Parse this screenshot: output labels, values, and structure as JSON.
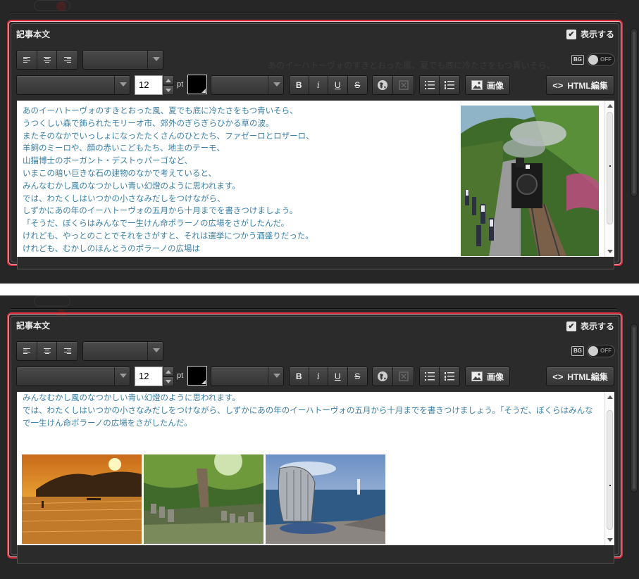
{
  "editor": {
    "title": "記事本文",
    "show_label": "表示する",
    "show_checked": true,
    "bg_label": "BG",
    "bg_toggle_label": "OFF",
    "font_size": "12",
    "font_unit": "pt",
    "text_color": "#000000",
    "bold_label": "B",
    "italic_label": "i",
    "underline_label": "U",
    "strike_label": "S",
    "image_button_label": "画像",
    "html_edit_label": "HTML編集",
    "code_glyph": "〈〉"
  },
  "screen1": {
    "text_lines": [
      "あのイーハトーヴォのすきとおった風、夏でも底に冷たさをもつ青いそら、",
      "うつくしい森で飾られたモリーオ市、郊外のぎらぎらひかる草の波。",
      "またそのなかでいっしょになったたくさんのひとたち、ファゼーロとロザーロ、",
      "羊飼のミーロや、顔の赤いこどもたち、地主のテーモ、",
      "山猫博士のボーガント・デストゥパーゴなど、",
      "いまこの暗い巨きな石の建物のなかで考えていると、",
      "みんなむかし風のなつかしい青い幻燈のように思われます。",
      "では、わたくしはいつかの小さなみだしをつけながら、",
      "しずかにあの年のイーハトーヴォの五月から十月までを書きつけましょう。",
      "「そうだ、ぼくらはみんなで一生けん命ポラーノの広場をさがしたんだ。",
      "けれども、やっとのことでそれをさがすと、それは選挙につかう酒盛りだった。",
      "けれども、むかしのほんとうのポラーノの広場は"
    ]
  },
  "screen2": {
    "text_lines": [
      "みんなむかし風のなつかしい青い幻燈のように思われます。",
      "では、わたくしはいつかの小さなみだしをつけながら、しずかにあの年のイーハトーヴォの五月から十月までを書きつけましょう。「そうだ、ぼくらはみんなで一生けん命ポラーノの広場をさがしたんだ。"
    ]
  },
  "ghost_text": "あのイーハトーヴォのすきとおった風、夏でも底に冷たさをもつ青いそら、",
  "colors": {
    "highlight_border": "#d42a3a",
    "text": "#3a7fa6",
    "panel_bg": "#262626"
  }
}
